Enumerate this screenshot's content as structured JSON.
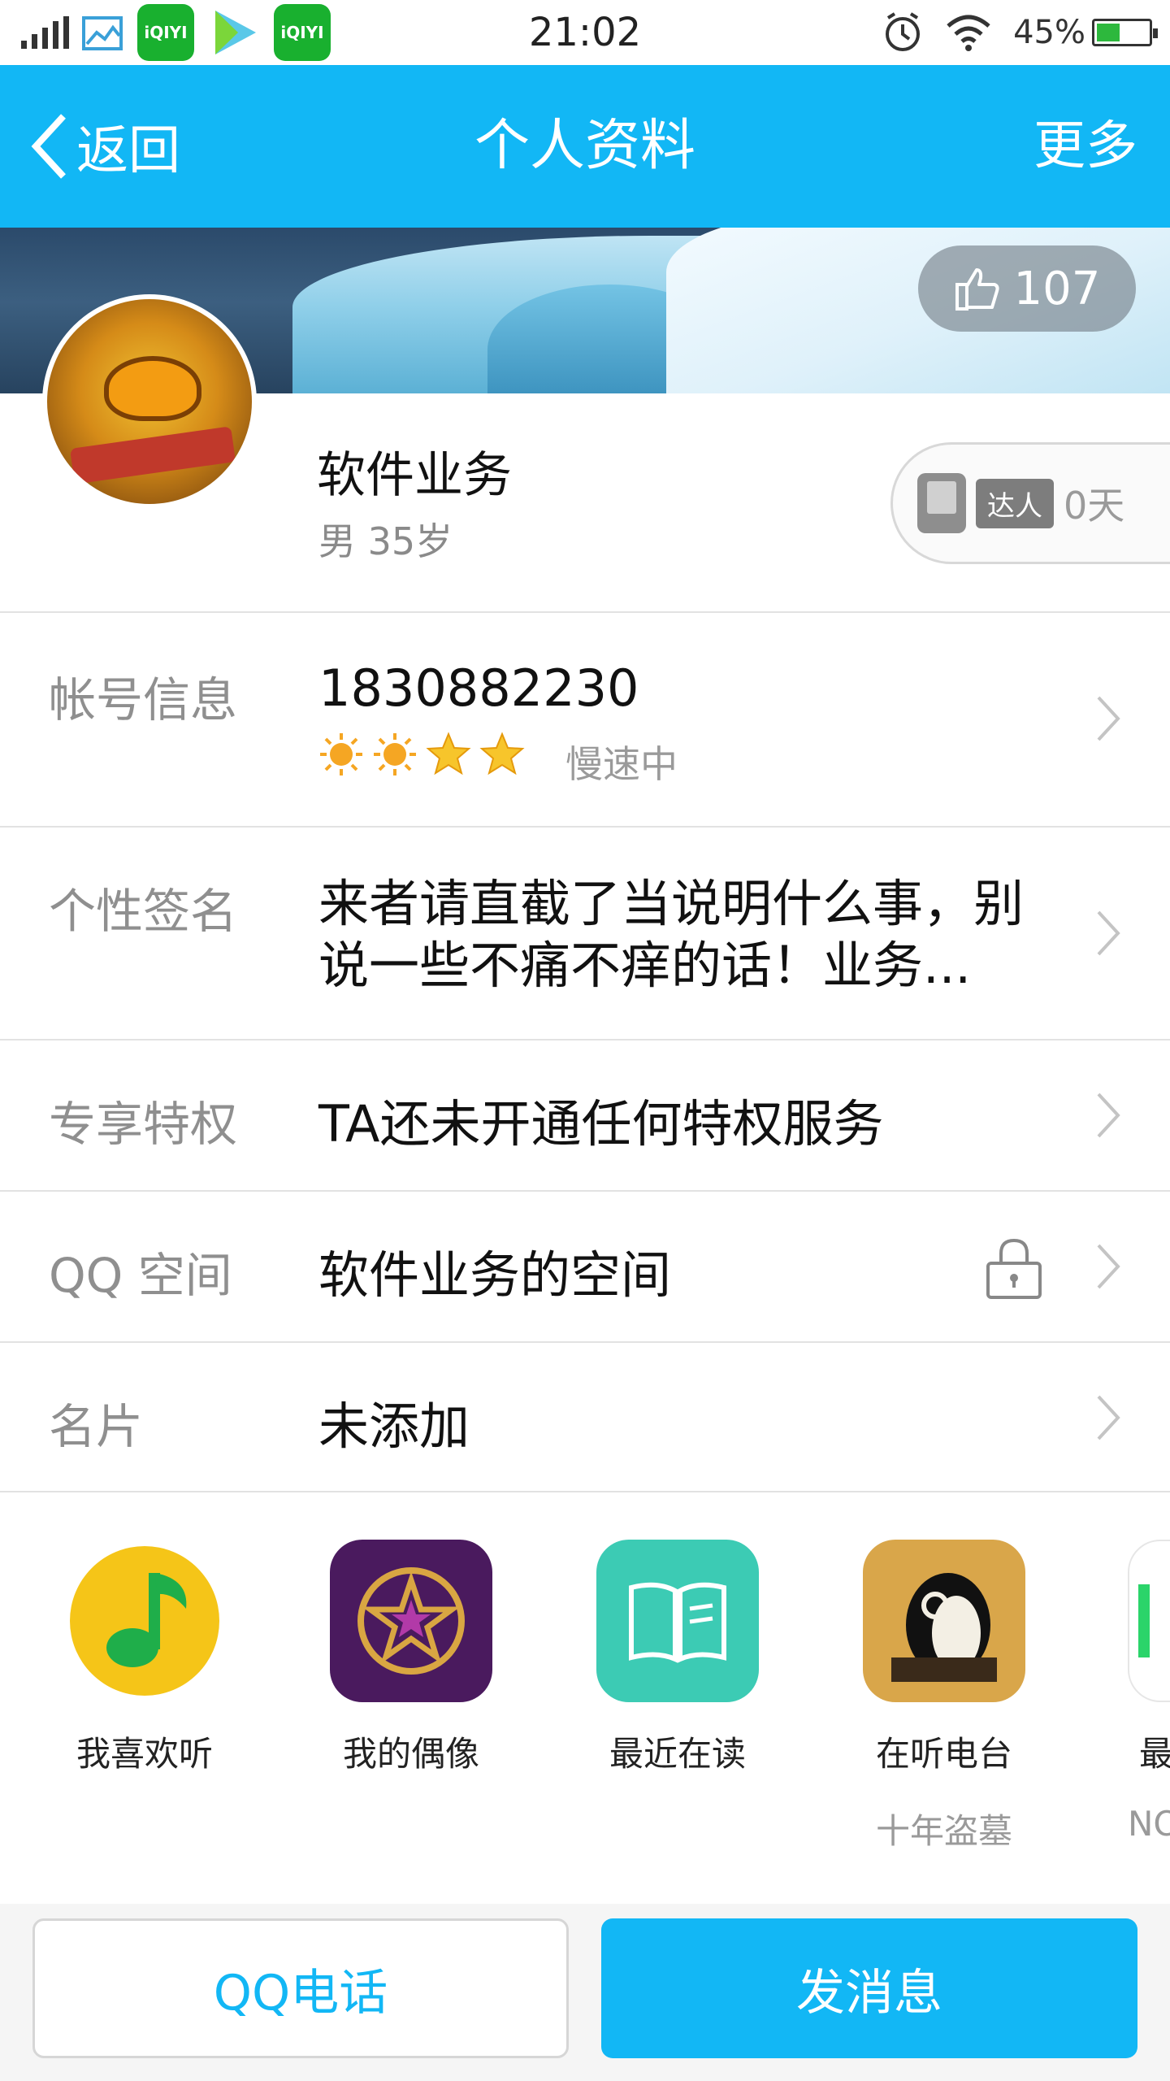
{
  "status_bar": {
    "time": "21:02",
    "battery": "45%",
    "battery_level": 0.45,
    "app_icons": [
      "iqiyi-icon",
      "video-player-icon",
      "iqiyi-icon"
    ],
    "iqiyi_label": "iQIYI"
  },
  "header": {
    "back_label": "返回",
    "title": "个人资料",
    "more_label": "更多",
    "background": "#12b7f5"
  },
  "profile": {
    "likes": "107",
    "nickname": "软件业务",
    "gender_age": "男 35岁",
    "talent_tag": "达人",
    "talent_days": "0天"
  },
  "rows": [
    {
      "label": "帐号信息",
      "value": "1830882230",
      "level_icons": [
        "sun",
        "sun",
        "star",
        "star"
      ],
      "status": "慢速中"
    },
    {
      "label": "个性签名",
      "value_line1": "来者请直截了当说明什么事，别",
      "value_line2": "说一些不痛不痒的话！业务..."
    },
    {
      "label": "专享特权",
      "value": "TA还未开通任何特权服务"
    },
    {
      "label": "QQ 空间",
      "value": "软件业务的空间",
      "lock": true
    },
    {
      "label": "名片",
      "value": "未添加"
    }
  ],
  "apps": [
    {
      "name": "我喜欢听",
      "icon": "music-note-icon",
      "color": "#f5c518"
    },
    {
      "name": "我的偶像",
      "icon": "star-badge-icon",
      "color": "#4a1a5e"
    },
    {
      "name": "最近在读",
      "icon": "book-icon",
      "color": "#3ccbb4"
    },
    {
      "name": "在听电台",
      "subtitle": "十年盗墓",
      "icon": "radio-penguin-icon",
      "color": "#d9a64a"
    },
    {
      "name": "最",
      "subtitle": "NO",
      "icon": "app-icon",
      "color": "#ffffff"
    }
  ],
  "bottom": {
    "call_label": "QQ电话",
    "message_label": "发消息"
  }
}
